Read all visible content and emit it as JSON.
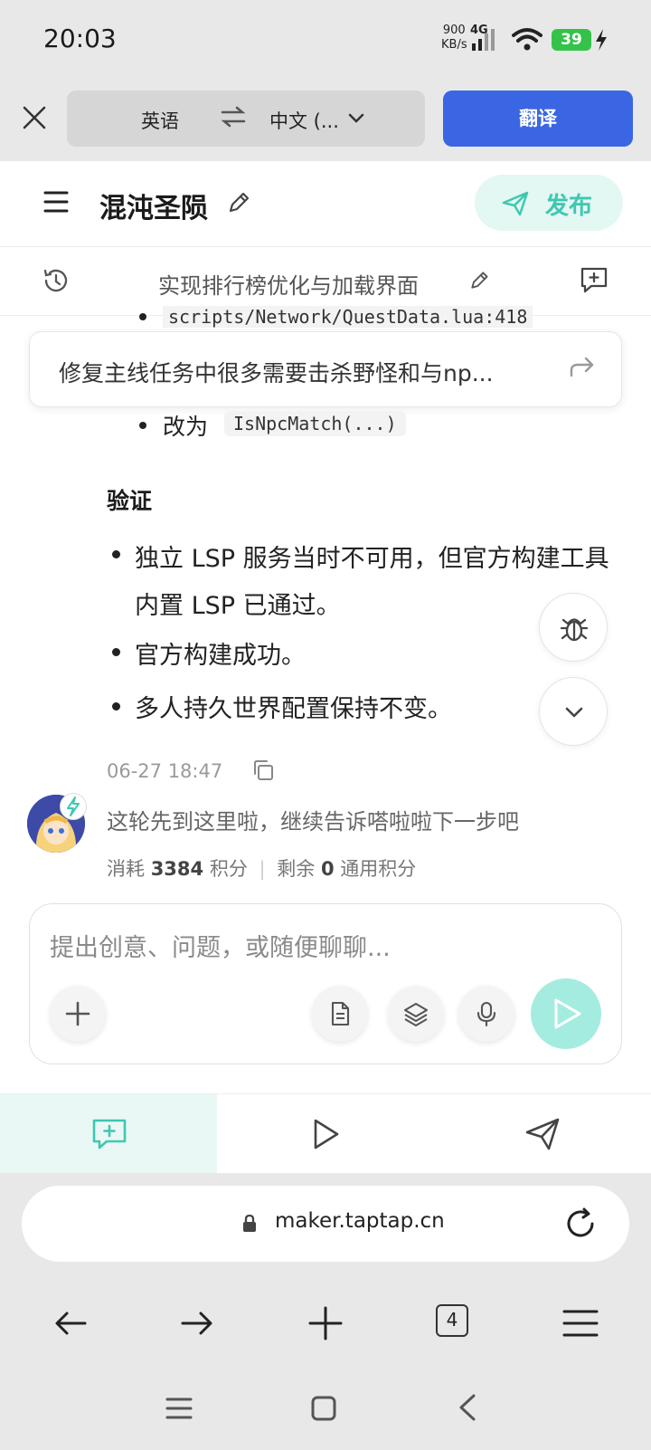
{
  "status_bar": {
    "time": "20:03",
    "net_speed_value": "900",
    "net_speed_unit": "KB/s",
    "network": "4G",
    "battery": "39"
  },
  "translate_bar": {
    "source_lang": "英语",
    "target_lang": "中文 (...",
    "translate_button": "翻译"
  },
  "header": {
    "project_title": "混沌圣陨",
    "publish_label": "发布"
  },
  "task_bar": {
    "title": "实现排行榜优化与加载界面"
  },
  "content": {
    "code_path": "scripts/Network/QuestData.lua:418",
    "pinned_message": "修复主线任务中很多需要击杀野怪和与np...",
    "change_to": "改为",
    "code_call": "IsNpcMatch(...)",
    "verify_heading": "验证",
    "bullets": [
      "独立 LSP 服务当时不可用，但官方构建工具内置 LSP 已通过。",
      "官方构建成功。",
      "多人持久世界配置保持不变。"
    ],
    "message_time": "06-27 18:47",
    "assistant_message": "这轮先到这里啦，继续告诉嗒啦啦下一步吧",
    "usage": {
      "consumed_label": "消耗",
      "consumed_value": "3384",
      "consumed_unit": "积分",
      "remaining_label": "剩余",
      "remaining_value": "0",
      "remaining_unit": "通用积分"
    }
  },
  "input": {
    "placeholder": "提出创意、问题，或随便聊聊..."
  },
  "browser": {
    "url": "maker.taptap.cn",
    "tab_count": "4"
  },
  "colors": {
    "accent_teal": "#40c7b1",
    "translate_blue": "#3a66e3",
    "battery_green": "#35c24a"
  }
}
